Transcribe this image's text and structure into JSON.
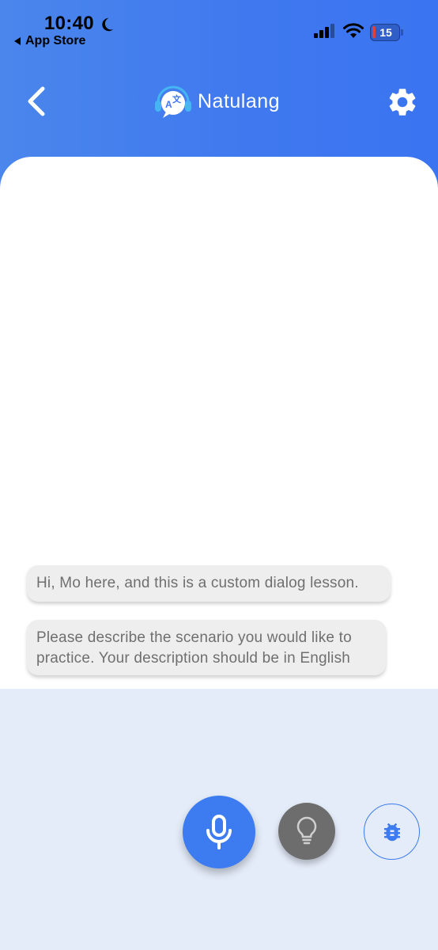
{
  "status_bar": {
    "time": "10:40",
    "back_app_label": "App Store",
    "battery_level": "15"
  },
  "header": {
    "app_name": "Natulang",
    "logo_letters": "A",
    "logo_letters_2": "文"
  },
  "chat": {
    "messages": [
      {
        "text": "Hi, Mo here, and this is a custom dialog lesson."
      },
      {
        "text": "Please describe the scenario you would like to practice. Your description should be in English"
      }
    ]
  },
  "colors": {
    "header_blue": "#3f78ef",
    "mic_blue": "#3c7bf0",
    "hint_gray": "#6d6d6d",
    "bottom_bg": "#e4ecf9"
  },
  "icons": {
    "back": "chevron-left-icon",
    "settings": "gear-icon",
    "mic": "microphone-icon",
    "hint": "lightbulb-icon",
    "bug": "bug-icon"
  }
}
